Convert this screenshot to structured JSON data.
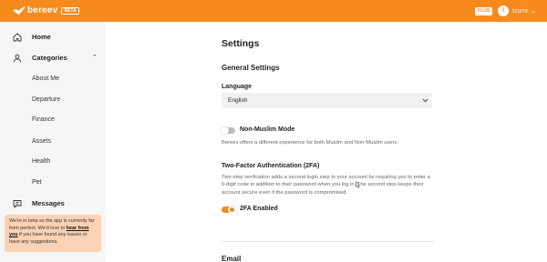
{
  "header": {
    "brand": "bereev",
    "beta_badge": "BETA",
    "plus_badge": "PLUS",
    "avatar_initial": "I",
    "username": "Izumi",
    "caret": "⌄"
  },
  "sidebar": {
    "home": "Home",
    "categories": "Categories",
    "categories_chevron": "⌃",
    "sub_items": [
      "About Me",
      "Departure",
      "Finance",
      "Assets",
      "Health",
      "Pet"
    ],
    "messages": "Messages",
    "beta_note": {
      "pre": "We're in beta so the app is currently far from perfect. We'd love to ",
      "link": "hear from you",
      "post": " if you have found any issues or have any suggestions."
    }
  },
  "settings": {
    "title": "Settings",
    "general_heading": "General Settings",
    "language_label": "Language",
    "language_value": "English",
    "non_muslim_label": "Non-Muslim Mode",
    "non_muslim_on": false,
    "non_muslim_desc": "Bereev offers a different experience for both Muslim and Non-Muslim users.",
    "twofa_heading": "Two-Factor Authentication (2FA)",
    "twofa_desc": "Two-step verification adds a second login step to your account by requiring you to enter a 6-digit code in addition to their password when you log in. The second step keeps their account secure even if the password is compromised.",
    "twofa_label": "2FA Enabled",
    "twofa_on": true,
    "email_heading": "Email"
  },
  "colors": {
    "brand_orange": "#f78a1d",
    "beta_note_bg": "#fbd2b4"
  }
}
